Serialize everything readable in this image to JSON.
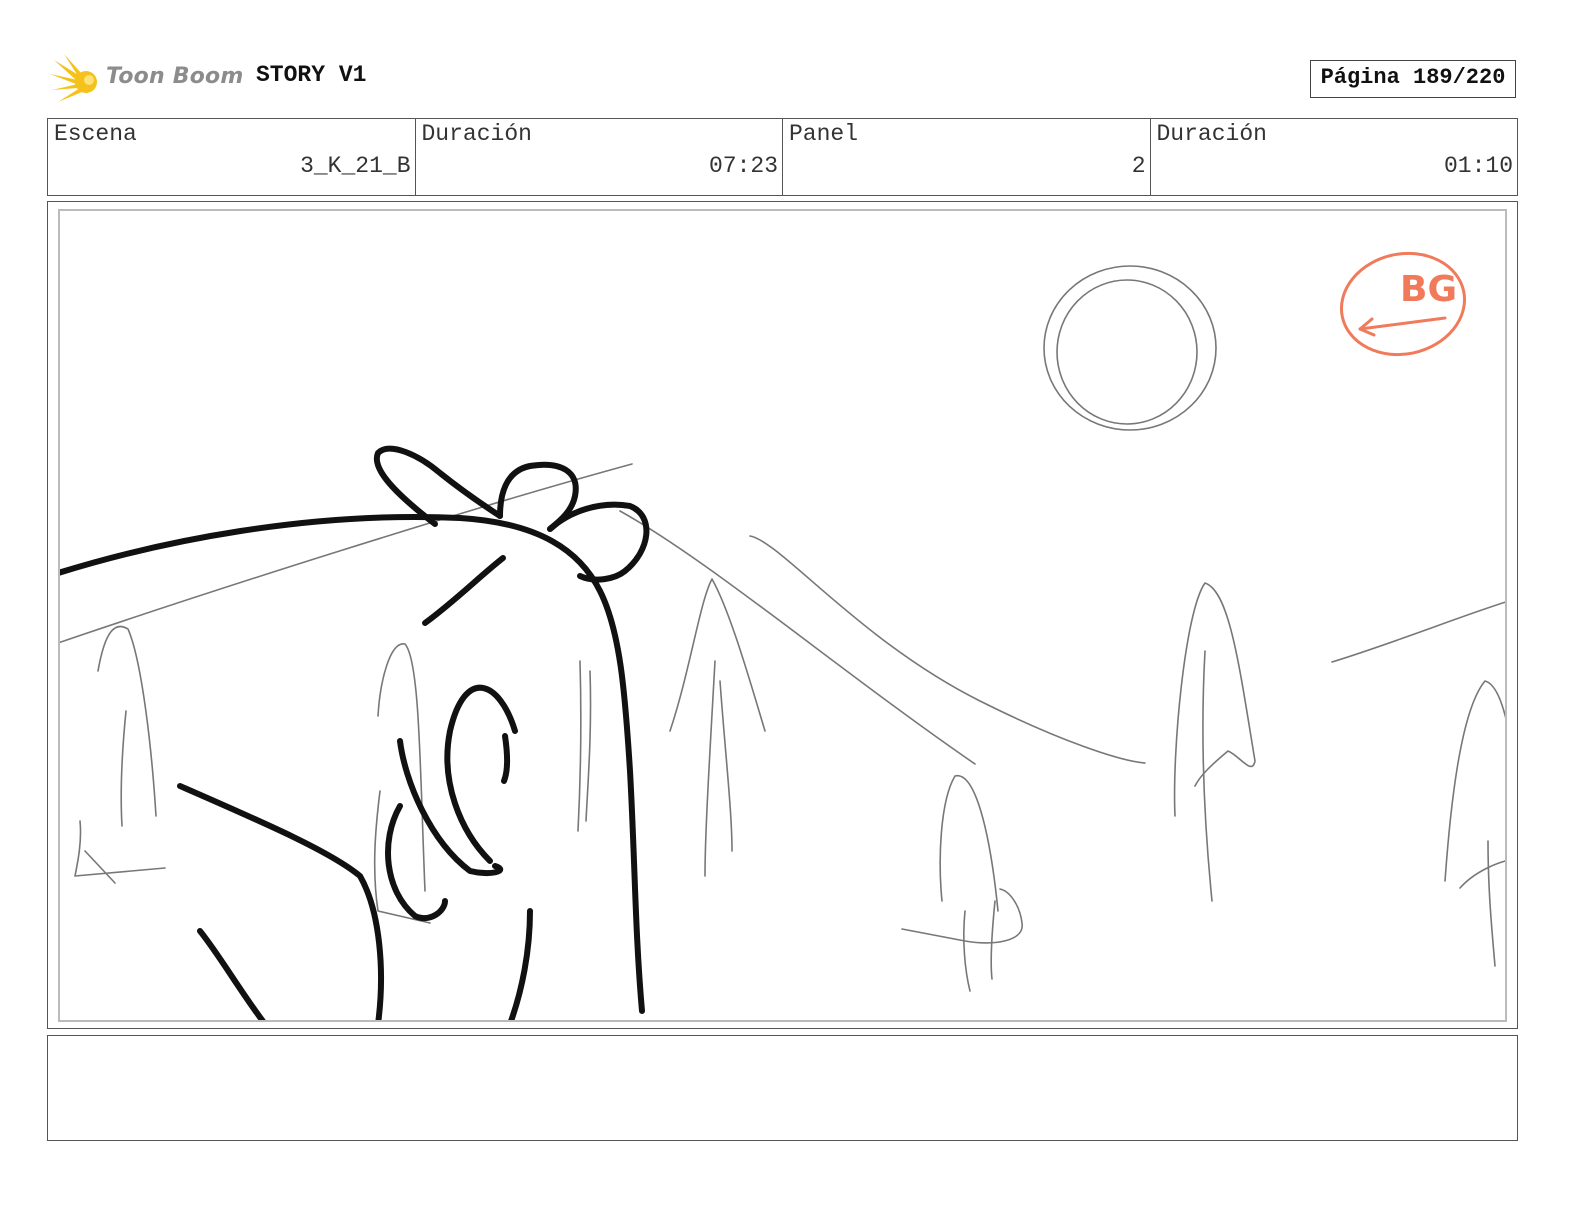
{
  "header": {
    "logo_text": "Toon Boom",
    "project_title": "STORY V1",
    "page_label": "Página 189/220"
  },
  "info": {
    "scene_label": "Escena",
    "scene_value": "3_K_21_B",
    "scene_duration_label": "Duración",
    "scene_duration_value": "07:23",
    "panel_label": "Panel",
    "panel_value": "2",
    "panel_duration_label": "Duración",
    "panel_duration_value": "01:10"
  },
  "panel_annotation": {
    "text": "BG",
    "color": "#f07a5a"
  },
  "colors": {
    "logo_star": "#f5c21b",
    "sketch_light": "#777777",
    "sketch_dark": "#111111"
  },
  "notes": {
    "text": ""
  }
}
